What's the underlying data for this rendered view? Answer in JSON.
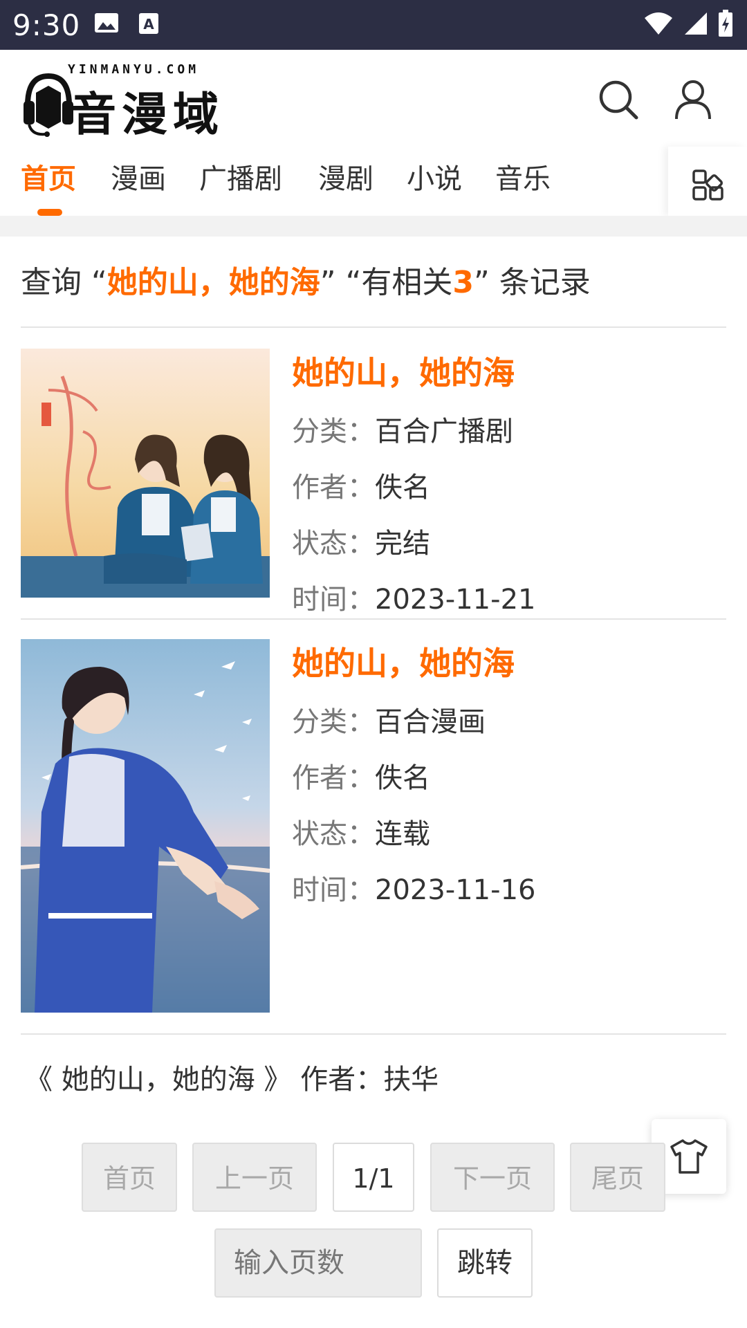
{
  "status_bar": {
    "time": "9:30",
    "left_icons": [
      "image-icon",
      "font-icon"
    ],
    "right_icons": [
      "wifi-icon",
      "signal-icon",
      "battery-icon"
    ]
  },
  "header": {
    "logo_domain": "YINMANYU.COM",
    "logo_text": "音漫域",
    "icons": [
      "search-icon",
      "user-icon"
    ]
  },
  "tabs": [
    {
      "label": "首页",
      "active": true
    },
    {
      "label": "漫画",
      "active": false
    },
    {
      "label": "广播剧",
      "active": false
    },
    {
      "label": "漫剧",
      "active": false
    },
    {
      "label": "小说",
      "active": false
    },
    {
      "label": "音乐",
      "active": false
    }
  ],
  "search_summary": {
    "prefix": "查询 “",
    "query": "她的山，她的海",
    "middle": "” “有相关",
    "count": "3",
    "suffix": "” 条记录"
  },
  "results": [
    {
      "title": "她的山，她的海",
      "category_label": "分类：",
      "category": "百合广播剧",
      "author_label": "作者：",
      "author": "佚名",
      "status_label": "状态：",
      "status": "完结",
      "time_label": "时间：",
      "time": "2023-11-21"
    },
    {
      "title": "她的山，她的海",
      "category_label": "分类：",
      "category": "百合漫画",
      "author_label": "作者：",
      "author": "佚名",
      "status_label": "状态：",
      "status": "连载",
      "time_label": "时间：",
      "time": "2023-11-16"
    }
  ],
  "third_result_text": "《 她的山，她的海 》 作者：扶华",
  "pagination": {
    "first": "首页",
    "prev": "上一页",
    "current": "1/1",
    "next": "下一页",
    "last": "尾页",
    "input_placeholder": "输入页数",
    "jump": "跳转"
  },
  "colors": {
    "accent": "#ff6a00",
    "status_bar": "#2c2e44"
  }
}
